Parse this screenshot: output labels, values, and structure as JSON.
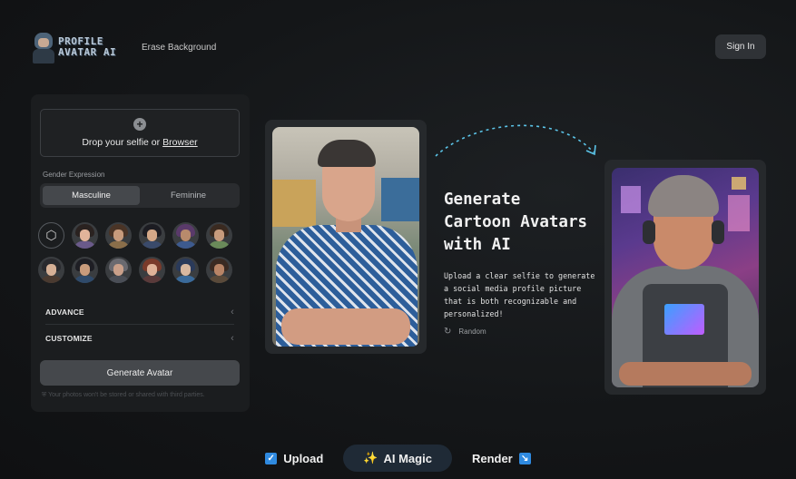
{
  "header": {
    "logo_line1": "PROFILE",
    "logo_line2": "AVATAR AI",
    "nav_erase": "Erase Background",
    "signin_label": "Sign In"
  },
  "panel": {
    "drop_text": "Drop your selfie or",
    "drop_link": "Browser",
    "gender_label": "Gender Expression",
    "gender_options": [
      "Masculine",
      "Feminine"
    ],
    "gender_selected": "Masculine",
    "advance_label": "ADVANCE",
    "customize_label": "CUSTOMIZE",
    "generate_label": "Generate Avatar",
    "privacy_text": "Your photos won't be stored or shared with third parties."
  },
  "hero": {
    "title_line1": "Generate",
    "title_line2": "Cartoon Avatars",
    "title_line3": "with AI",
    "description": "Upload a clear selfie to generate a social media profile picture that is both recognizable and personalized!",
    "random_label": "Random"
  },
  "steps": {
    "upload": "Upload",
    "magic": "AI Magic",
    "render": "Render"
  },
  "colors": {
    "accent_blue": "#2f8ae0",
    "arrow_cyan": "#5bc4e8"
  }
}
